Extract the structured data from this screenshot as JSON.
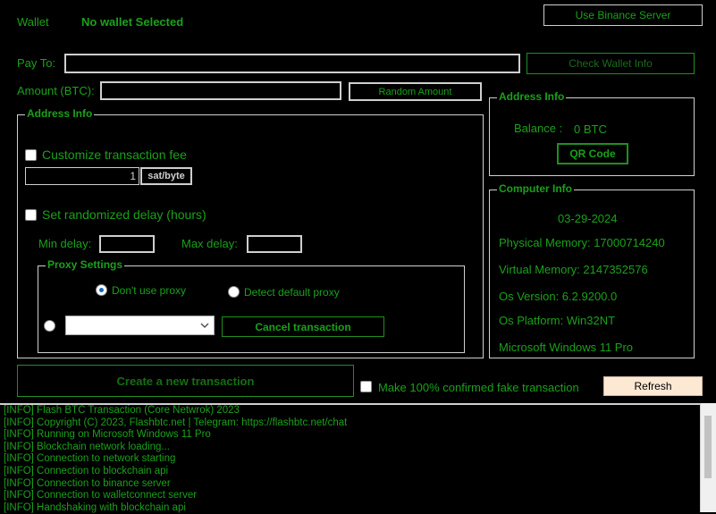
{
  "header": {
    "wallet_label": "Wallet",
    "wallet_value": "No wallet Selected",
    "binance_button": "Use Binance Server"
  },
  "pay_to": {
    "label": "Pay To:",
    "value": ""
  },
  "check_wallet_button": "Check Wallet Info",
  "amount": {
    "label": "Amount (BTC):",
    "value": ""
  },
  "random_amount_button": "Random Amount",
  "address_info_left": {
    "title": "Address Info",
    "customize_fee_label": "Customize transaction fee",
    "fee_value": "1",
    "fee_unit": "sat/byte",
    "random_delay_label": "Set randomized delay (hours)",
    "min_delay_label": "Min delay:",
    "max_delay_label": "Max delay:",
    "min_delay_value": "",
    "max_delay_value": ""
  },
  "proxy": {
    "title": "Proxy Settings",
    "dont_use_label": "Don't use proxy",
    "detect_label": "Detect default proxy",
    "selected": "Don't use proxy",
    "combo_value": "",
    "cancel_button": "Cancel transaction"
  },
  "address_info_right": {
    "title": "Address Info",
    "balance_label": "Balance :",
    "balance_value": "0 BTC",
    "qr_button": "QR Code"
  },
  "computer_info": {
    "title": "Computer Info",
    "date": "03-29-2024",
    "physical_memory": "Physical Memory: 17000714240",
    "virtual_memory": "Virtual Memory: 2147352576",
    "os_version": "Os Version: 6.2.9200.0",
    "os_platform": "Os Platform: Win32NT",
    "os_name": "Microsoft Windows 11 Pro"
  },
  "create_button": "Create a new transaction",
  "fake_confirm_label": "Make 100% confirmed fake transaction",
  "refresh_button": "Refresh",
  "log": [
    "[INFO] Flash BTC Transaction (Core Netwrok) 2023",
    "[INFO] Copyright (C) 2023, Flashbtc.net | Telegram: https://flashbtc.net/chat",
    "[INFO] Running on Microsoft Windows 11 Pro",
    "[INFO] Blockchain network loading...",
    "[INFO] Connection to network starting",
    "[INFO] Connection to blockchain api",
    "[INFO] Connection to binance server",
    "[INFO] Connection to walletconnect server",
    "[INFO] Handshaking with blockchain api"
  ],
  "colors": {
    "accent": "#1aa11a",
    "background": "#000000",
    "refresh_bg": "#fde8d4"
  }
}
